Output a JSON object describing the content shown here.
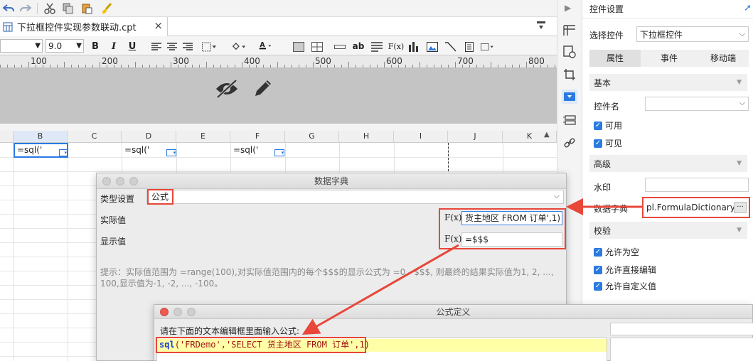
{
  "toolbar": {
    "undo_icon": "undo-icon",
    "redo_icon": "redo-icon",
    "cut_icon": "cut-icon",
    "copy_icon": "copy-icon",
    "paste_icon": "paste-icon",
    "format_painter_icon": "brush-icon"
  },
  "tab": {
    "title": "下拉框控件实现参数联动.cpt",
    "close": "×"
  },
  "format": {
    "font_size": "9.0",
    "bold": "B",
    "italic": "I",
    "underline": "U",
    "ab": "ab",
    "fx": "F(x)"
  },
  "ruler": {
    "marks": [
      "100",
      "200",
      "300",
      "400",
      "500",
      "600",
      "700",
      "800"
    ]
  },
  "columns": [
    "B",
    "C",
    "D",
    "E",
    "F",
    "G",
    "H",
    "I",
    "J",
    "K"
  ],
  "cells": {
    "b": "=sql('",
    "d": "=sql('",
    "f": "=sql('"
  },
  "right_panel": {
    "title": "控件设置",
    "select_label": "选择控件",
    "select_value": "下拉框控件",
    "tabs": [
      "属性",
      "事件",
      "移动端"
    ],
    "section_basic": "基本",
    "name_label": "控件名",
    "enabled": "可用",
    "visible": "可见",
    "section_advanced": "高级",
    "watermark_label": "水印",
    "dict_label": "数据字典",
    "dict_value": "pl.FormulaDictionary",
    "dict_more": "···",
    "section_validate": "校验",
    "allow_empty": "允许为空",
    "allow_edit": "允许直接编辑",
    "allow_custom": "允许自定义值"
  },
  "dict_dialog": {
    "title": "数据字典",
    "type_label": "类型设置",
    "type_value": "公式",
    "actual_label": "实际值",
    "actual_value": "货主地区 FROM 订单',1)",
    "display_label": "显示值",
    "display_value": "=$$$",
    "fx": "F(x)",
    "hint": "提示：实际值范围为 =range(100),对实际值范围内的每个$$$的显示公式为 =0 - $$$, 则最终的结果实际值为1, 2, ..., 100,显示值为-1, -2, ..., -100。"
  },
  "formula_dialog": {
    "title": "公式定义",
    "prompt": "请在下面的文本编辑框里面输入公式:",
    "formula_fn": "sql",
    "formula_args": "('FRDemo','SELECT 货主地区 FROM 订单',1)"
  },
  "colors": {
    "red": "#e8473a",
    "selection": "#2a7ae2",
    "highlight": "#ffffa8"
  }
}
